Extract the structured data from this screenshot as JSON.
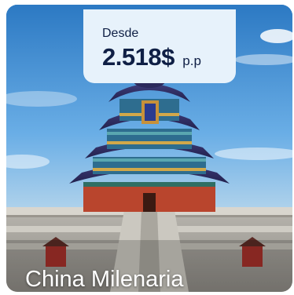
{
  "card": {
    "price_prefix": "Desde",
    "price_amount": "2.518$",
    "price_unit": "p.p",
    "title": "China Milenaria"
  },
  "colors": {
    "badge_background": "#e7f2fb",
    "badge_text": "#0f1f45",
    "title_text": "#ffffff"
  }
}
